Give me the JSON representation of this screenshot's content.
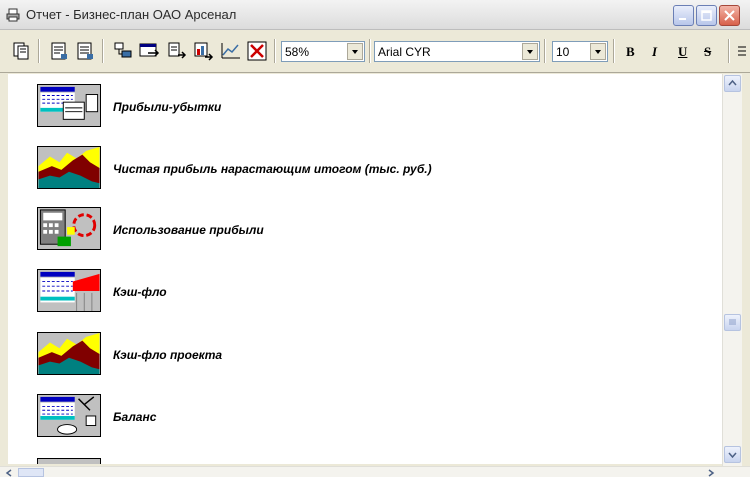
{
  "window": {
    "title": "Отчет - Бизнес-план ОАО Арсенал",
    "app_icon": "printer-icon",
    "controls": [
      "minimize-icon",
      "maximize-icon",
      "close-icon"
    ]
  },
  "toolbar": {
    "buttons": [
      "copy-pages-icon",
      "page-icon",
      "page-lines-icon",
      "tree-icon",
      "window-arrow-icon",
      "export-icon",
      "chart-export-icon",
      "line-chart-icon",
      "delete-icon"
    ],
    "zoom": "58%",
    "font_name": "Arial CYR",
    "font_size": "10",
    "format": {
      "bold": "B",
      "italic": "I",
      "underline": "U",
      "strike": "S"
    }
  },
  "report": {
    "items": [
      {
        "label": "Прибыли-убытки",
        "icon": "table-doc-icon"
      },
      {
        "label": "Чистая прибыль нарастающим итогом (тыс. руб.)",
        "icon": "area-chart-icon"
      },
      {
        "label": "Использование прибыли",
        "icon": "calculator-cycle-icon"
      },
      {
        "label": "Кэш-фло",
        "icon": "table-flow-icon"
      },
      {
        "label": "Кэш-фло проекта",
        "icon": "area-chart-icon"
      },
      {
        "label": "Баланс",
        "icon": "balance-scale-icon"
      }
    ]
  },
  "colors": {
    "title_inactive": "#2b2b2b",
    "xp_blue": "#3a6ea5",
    "chart_yellow": "#ffff00",
    "chart_red": "#8b0000",
    "chart_teal": "#008080"
  }
}
